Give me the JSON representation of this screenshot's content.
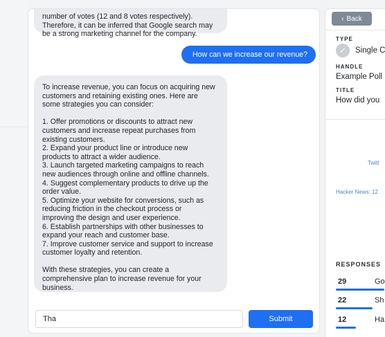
{
  "chat": {
    "messages": [
      {
        "role": "assistant",
        "text": "number of votes (12 and 8 votes respectively).\nTherefore, it can be inferred that Google search may\nbe a strong marketing channel for the company."
      },
      {
        "role": "user",
        "text": "How can we increase our revenue?"
      },
      {
        "role": "assistant",
        "text": "To increase revenue, you can focus on acquiring new\ncustomers and retaining existing ones. Here are\nsome strategies you can consider:\n\n1. Offer promotions or discounts to attract new\ncustomers and increase repeat purchases from\nexisting customers.\n2. Expand your product line or introduce new\nproducts to attract a wider audience.\n3. Launch targeted marketing campaigns to reach\nnew audiences through online and offline channels.\n4. Suggest complementary products to drive up the\norder value.\n5. Optimize your website for conversions, such as\nreducing friction in the checkout process or\nimproving the design and user experience.\n6. Establish partnerships with other businesses to\nexpand your reach and customer base.\n7. Improve customer service and support to increase\ncustomer loyalty and retention.\n\nWith these strategies, you can create a\ncomprehensive plan to increase revenue for your\nbusiness."
      }
    ],
    "input_value": "Tha",
    "submit_label": "Submit"
  },
  "detail": {
    "back_label": "Back",
    "type_label": "TYPE",
    "type_value": "Single C",
    "handle_label": "HANDLE",
    "handle_value": "Example Poll",
    "title_label": "TITLE",
    "title_value": "How did you"
  },
  "sources": {
    "twitter": "Twitt",
    "hacker_news": "Hacker News: 12"
  },
  "responses": {
    "label": "RESPONSES",
    "rows": [
      {
        "count": "29",
        "text": "Go",
        "share": 1.0
      },
      {
        "count": "22",
        "text": "Sh",
        "share": 0.76
      },
      {
        "count": "12",
        "text": "Ha",
        "share": 0.41
      }
    ]
  },
  "colors": {
    "accent": "#1e6ff2",
    "bot_bubble": "#e9ebee",
    "back_button": "#7f8a96"
  }
}
